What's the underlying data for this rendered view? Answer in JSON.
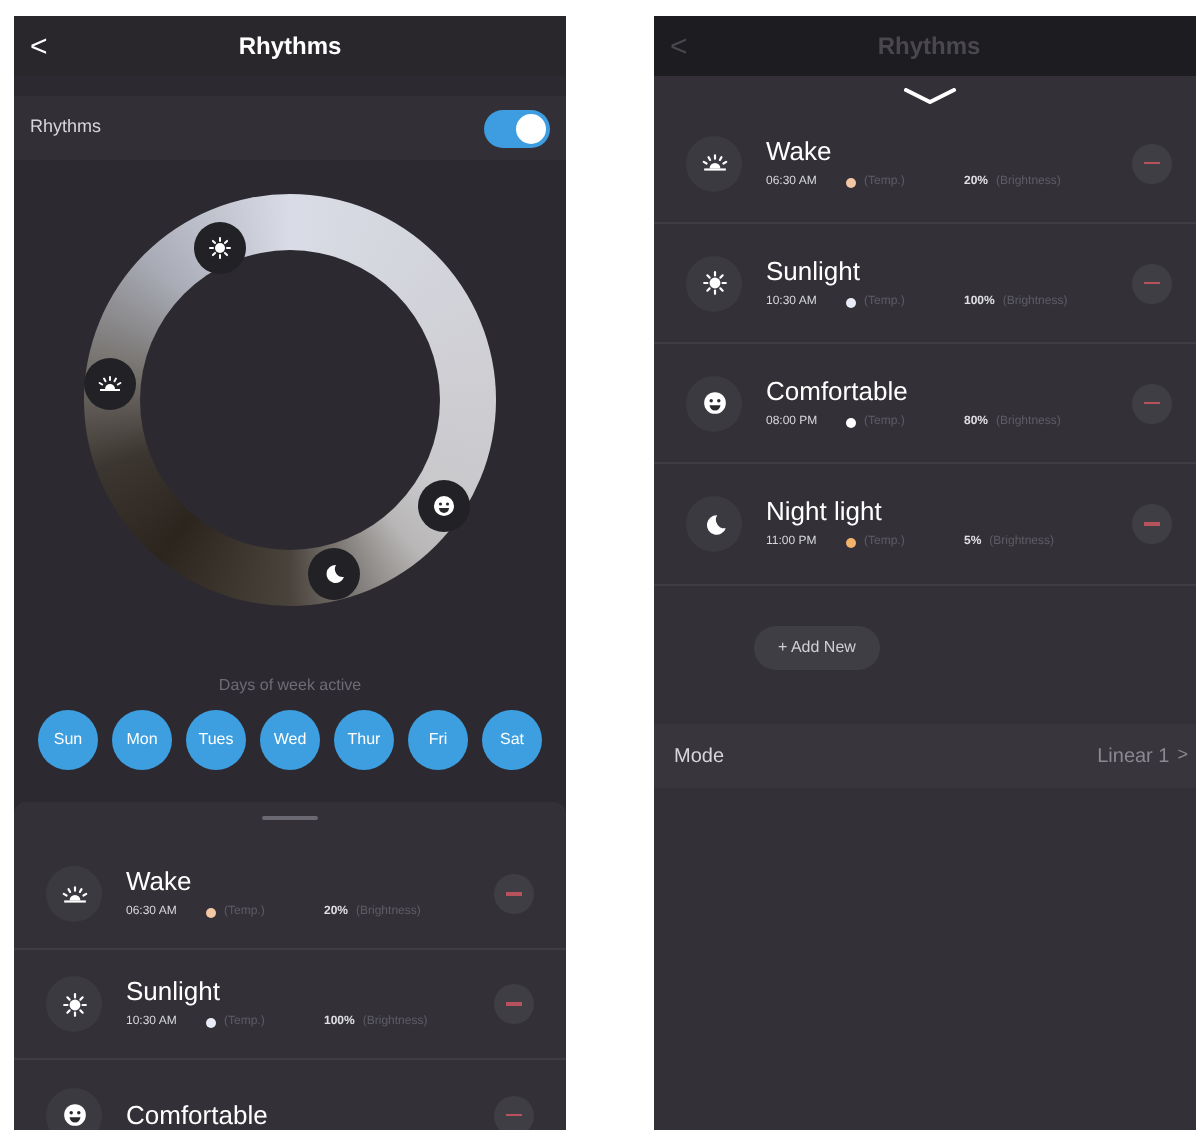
{
  "left_screen": {
    "header": {
      "back": "<",
      "title": "Rhythms"
    },
    "toggle_row": {
      "label": "Rhythms",
      "on": true
    },
    "wheel": {
      "markers": [
        {
          "kind": "sun"
        },
        {
          "kind": "sunrise"
        },
        {
          "kind": "smile"
        },
        {
          "kind": "moon"
        }
      ]
    },
    "days_label": "Days of week active",
    "days": [
      {
        "label": "Sun",
        "selected": true
      },
      {
        "label": "Mon",
        "selected": true
      },
      {
        "label": "Tues",
        "selected": true
      },
      {
        "label": "Wed",
        "selected": true
      },
      {
        "label": "Thur",
        "selected": true
      },
      {
        "label": "Fri",
        "selected": true
      },
      {
        "label": "Sat",
        "selected": true
      }
    ],
    "items": [
      {
        "kind": "sunrise",
        "name": "Wake",
        "time": "06:30 AM",
        "color": "#f3c7a3",
        "temp": "(Temp.)",
        "brightness": "20%",
        "brightness_label": "(Brightness)"
      },
      {
        "kind": "sun",
        "name": "Sunlight",
        "time": "10:30 AM",
        "color": "#e9ecf6",
        "temp": "(Temp.)",
        "brightness": "100%",
        "brightness_label": "(Brightness)"
      },
      {
        "kind": "smile",
        "name": "Comfortable"
      }
    ]
  },
  "right_screen": {
    "header": {
      "back": "<",
      "title": "Rhythms"
    },
    "items": [
      {
        "kind": "sunrise",
        "name": "Wake",
        "time": "06:30 AM",
        "color": "#f3c7a3",
        "temp": "(Temp.)",
        "brightness": "20%",
        "brightness_label": "(Brightness)"
      },
      {
        "kind": "sun",
        "name": "Sunlight",
        "time": "10:30 AM",
        "color": "#e9ecf6",
        "temp": "(Temp.)",
        "brightness": "100%",
        "brightness_label": "(Brightness)"
      },
      {
        "kind": "smile",
        "name": "Comfortable",
        "time": "08:00 PM",
        "color": "#ffffff",
        "temp": "(Temp.)",
        "brightness": "80%",
        "brightness_label": "(Brightness)"
      },
      {
        "kind": "moon",
        "name": "Night light",
        "time": "11:00 PM",
        "color": "#f1b36a",
        "temp": "(Temp.)",
        "brightness": "5%",
        "brightness_label": "(Brightness)"
      }
    ],
    "add_button": "+ Add New",
    "mode": {
      "label": "Mode",
      "value": "Linear 1",
      "chevron": ">"
    }
  }
}
